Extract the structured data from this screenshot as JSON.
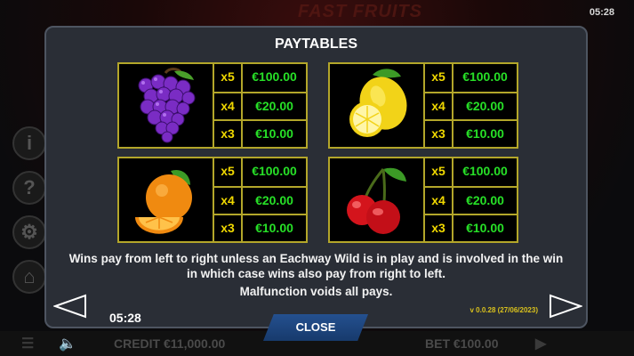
{
  "title": "PAYTABLES",
  "background": {
    "logo": "FAST FRUITS",
    "clock_top": "05:28",
    "credit_label": "CREDIT €11,000.00",
    "bet_label": "BET €100.00"
  },
  "paytables": [
    {
      "symbol": "grapes-icon",
      "rows": [
        {
          "mult": "x5",
          "amount": "€100.00"
        },
        {
          "mult": "x4",
          "amount": "€20.00"
        },
        {
          "mult": "x3",
          "amount": "€10.00"
        }
      ]
    },
    {
      "symbol": "lemon-icon",
      "rows": [
        {
          "mult": "x5",
          "amount": "€100.00"
        },
        {
          "mult": "x4",
          "amount": "€20.00"
        },
        {
          "mult": "x3",
          "amount": "€10.00"
        }
      ]
    },
    {
      "symbol": "orange-icon",
      "rows": [
        {
          "mult": "x5",
          "amount": "€100.00"
        },
        {
          "mult": "x4",
          "amount": "€20.00"
        },
        {
          "mult": "x3",
          "amount": "€10.00"
        }
      ]
    },
    {
      "symbol": "cherry-icon",
      "rows": [
        {
          "mult": "x5",
          "amount": "€100.00"
        },
        {
          "mult": "x4",
          "amount": "€20.00"
        },
        {
          "mult": "x3",
          "amount": "€10.00"
        }
      ]
    }
  ],
  "rules_text": "Wins pay from left to right unless an Eachway Wild is in play and is involved in the win in which case wins also pay from right to left.",
  "malfunction_text": "Malfunction voids all pays.",
  "version": "v 0.0.28 (27/06/2023)",
  "clock": "05:28",
  "close_label": "CLOSE",
  "colors": {
    "panel": "#2a2e36",
    "border_gold": "#b3a62a",
    "multiplier": "#f0d800",
    "amount": "#27e027",
    "close_button": "#1f4784"
  }
}
